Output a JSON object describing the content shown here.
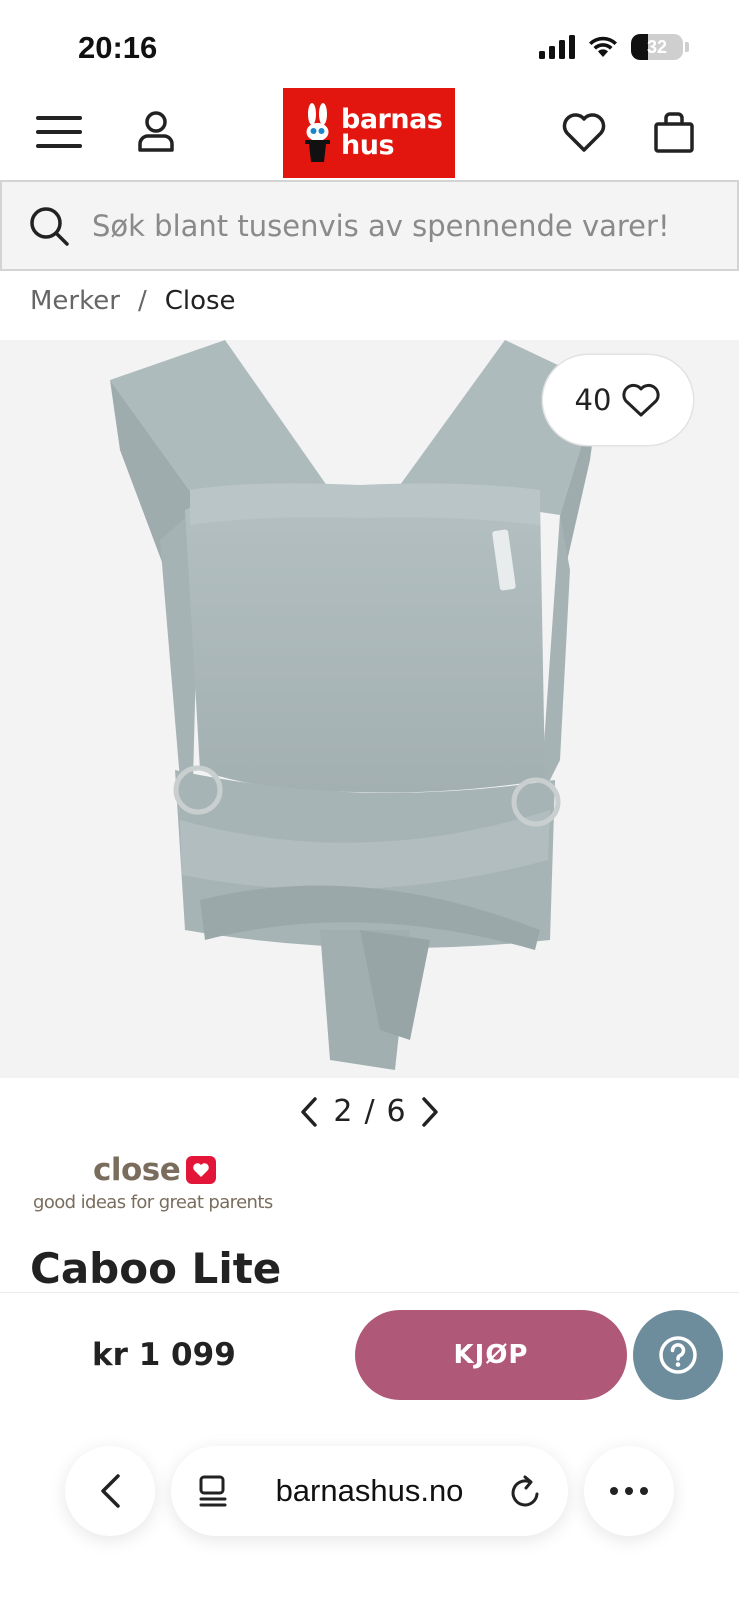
{
  "status": {
    "time": "20:16",
    "battery": "32",
    "battery_level": 0.32
  },
  "header": {
    "logo_line1": "barnas",
    "logo_line2": "hus"
  },
  "search": {
    "placeholder": "Søk blant tusenvis av spennende varer!"
  },
  "breadcrumb": {
    "items": [
      "Merker",
      "Close"
    ],
    "separator": "/"
  },
  "product": {
    "favorites_count": "40",
    "image_index": "2",
    "image_total": "6",
    "pager_sep": "/",
    "brand_name": "close",
    "brand_tagline": "good ideas for great parents",
    "title": "Caboo Lite"
  },
  "buy": {
    "price": "kr 1 099",
    "buy_label": "KJØP"
  },
  "browser": {
    "url": "barnashus.no"
  },
  "colors": {
    "brand_red": "#e3160f",
    "buy_button": "#b05878",
    "help_button": "#6e8d9c"
  }
}
